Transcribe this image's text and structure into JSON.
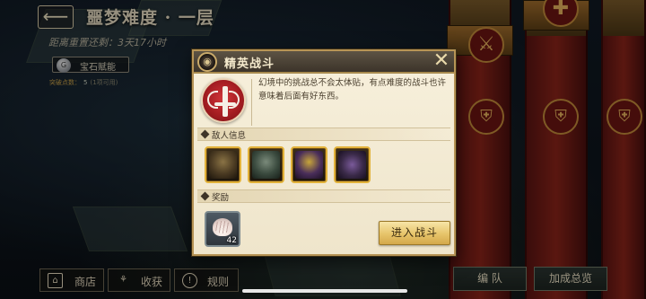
{
  "hud": {
    "back_icon": "back-arrow-icon",
    "stage_title": "噩梦难度 · 一层",
    "reset_timer": "距离重置还剩：3天17小时",
    "gem_button": "宝石赋能",
    "points_label": "突破点数：",
    "points_value": "5",
    "points_note": "(1项可用)"
  },
  "dialog": {
    "title": "精英战斗",
    "close_icon": "close-icon",
    "badge_icon": "elite-sword-badge-icon",
    "description": "幻境中的挑战总不会太体贴，有点难度的战斗也许意味着后面有好东西。",
    "enemy_section_label": "敌人信息",
    "enemies": [
      {
        "name": "dark-armored-knight",
        "color": "#4a3a22"
      },
      {
        "name": "rider-on-beast",
        "color": "#3a4a3e"
      },
      {
        "name": "horned-purple-demon",
        "color": "#4a2e5a"
      },
      {
        "name": "purple-spider",
        "color": "#3a2a48"
      }
    ],
    "reward_section_label": "奖励",
    "reward": {
      "item_icon": "shell-icon",
      "count": "42"
    },
    "enter_button": "进入战斗"
  },
  "bottom_bar": {
    "shop_label": "商店",
    "harvest_label": "收获",
    "rules_label": "规则",
    "team_label": "编 队",
    "bonus_label": "加成总览"
  },
  "colors": {
    "accent_gold": "#e2b23a",
    "badge_red": "#a51d22",
    "tower_red": "#8a2419"
  }
}
